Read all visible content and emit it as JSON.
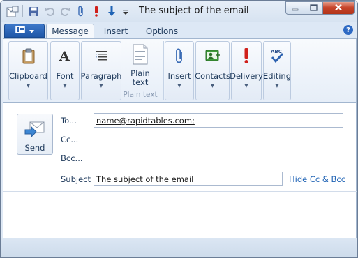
{
  "window": {
    "title": "The subject of the email"
  },
  "quick_access": [
    {
      "icon": "save-icon"
    },
    {
      "icon": "undo-icon"
    },
    {
      "icon": "redo-icon"
    },
    {
      "icon": "attach-icon"
    },
    {
      "icon": "high-importance-icon"
    },
    {
      "icon": "low-importance-icon"
    },
    {
      "icon": "customize-dropdown-icon"
    }
  ],
  "tabs": {
    "message": "Message",
    "insert": "Insert",
    "options": "Options"
  },
  "ribbon": {
    "clipboard": "Clipboard",
    "font": "Font",
    "paragraph": "Paragraph",
    "plain_text": "Plain text",
    "plain_text_group": "Plain text",
    "insert": "Insert",
    "contacts": "Contacts",
    "delivery": "Delivery",
    "editing": "Editing"
  },
  "compose": {
    "send_label": "Send",
    "to_label": "To...",
    "cc_label": "Cc...",
    "bcc_label": "Bcc...",
    "subject_label": "Subject",
    "to_value": "name@rapidtables.com;",
    "cc_value": "",
    "bcc_value": "",
    "subject_value": "The subject of the email",
    "hide_cc_bcc": "Hide Cc & Bcc"
  },
  "colors": {
    "accent": "#1f57a8",
    "link": "#1f63b5",
    "importance_high": "#d0201b",
    "importance_low": "#1f63b5"
  }
}
